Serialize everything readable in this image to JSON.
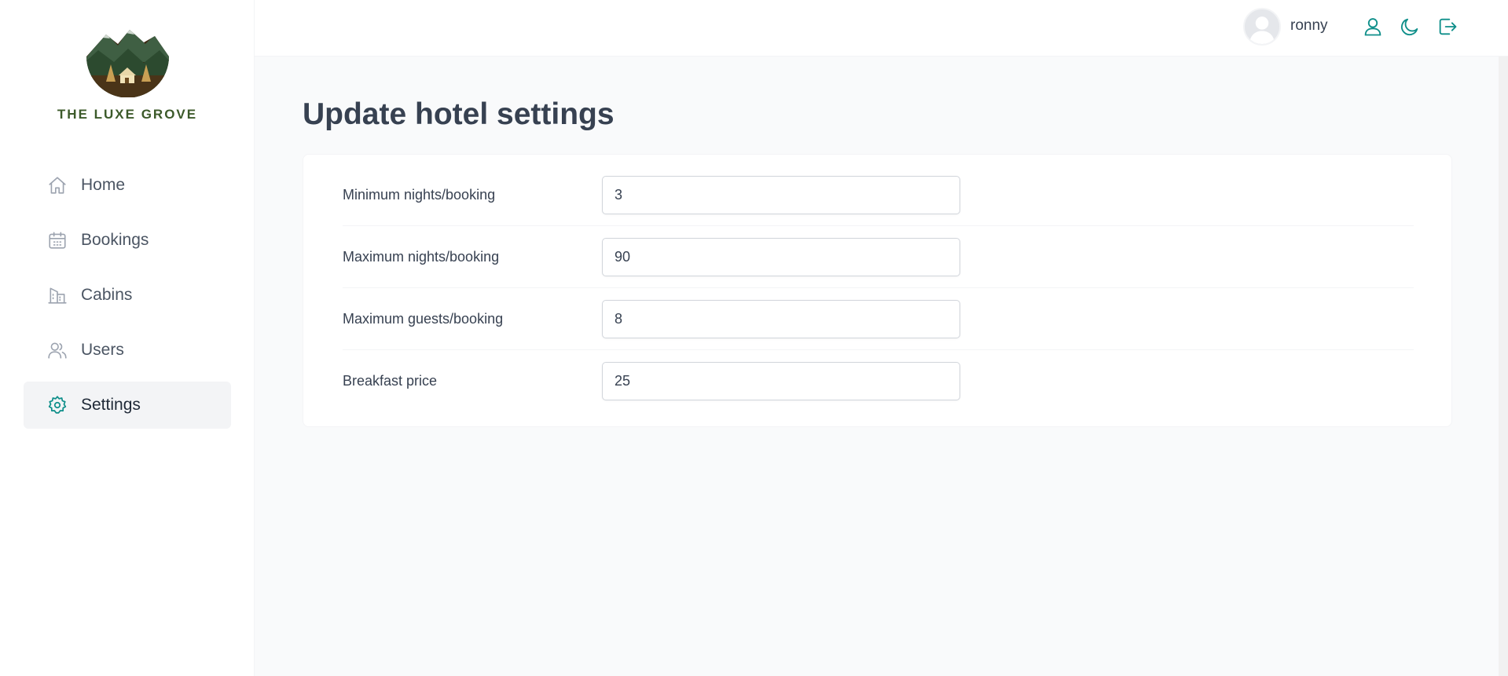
{
  "brand": {
    "name": "THE LUXE GROVE"
  },
  "sidebar": {
    "items": [
      {
        "label": "Home",
        "icon": "home-icon",
        "active": false
      },
      {
        "label": "Bookings",
        "icon": "calendar-icon",
        "active": false
      },
      {
        "label": "Cabins",
        "icon": "building-icon",
        "active": false
      },
      {
        "label": "Users",
        "icon": "users-icon",
        "active": false
      },
      {
        "label": "Settings",
        "icon": "gear-icon",
        "active": true
      }
    ]
  },
  "header": {
    "username": "ronny",
    "icons": [
      "user-icon",
      "moon-icon",
      "logout-icon"
    ]
  },
  "main": {
    "title": "Update hotel settings",
    "settings": [
      {
        "label": "Minimum nights/booking",
        "value": "3"
      },
      {
        "label": "Maximum nights/booking",
        "value": "90"
      },
      {
        "label": "Maximum guests/booking",
        "value": "8"
      },
      {
        "label": "Breakfast price",
        "value": "25"
      }
    ]
  },
  "colors": {
    "accent": "#0f8f8a",
    "icon_gray": "#9ca3af",
    "brand_green": "#3c5a2a",
    "background": "#f9fafb"
  }
}
